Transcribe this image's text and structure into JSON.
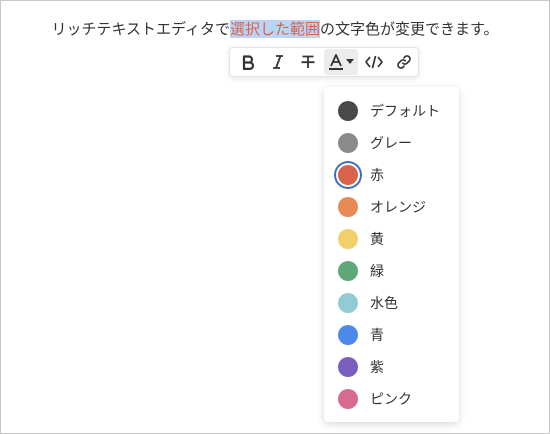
{
  "editor": {
    "text_before": "リッチテキストエディタで",
    "text_selected": "選択した範囲",
    "text_after": "の文字色が変更できます。"
  },
  "toolbar": {
    "buttons": [
      {
        "name": "bold-button",
        "icon": "bold-icon",
        "active": false
      },
      {
        "name": "italic-button",
        "icon": "italic-icon",
        "active": false
      },
      {
        "name": "strikethrough-button",
        "icon": "strikethrough-icon",
        "active": false
      },
      {
        "name": "text-color-button",
        "icon": "text-color-icon",
        "active": true
      },
      {
        "name": "code-button",
        "icon": "code-icon",
        "active": false
      },
      {
        "name": "link-button",
        "icon": "link-icon",
        "active": false
      }
    ]
  },
  "color_menu": {
    "selected": "赤",
    "items": [
      {
        "label": "デフォルト",
        "color": "#4a4a4a"
      },
      {
        "label": "グレー",
        "color": "#8a8a8a"
      },
      {
        "label": "赤",
        "color": "#d8634a"
      },
      {
        "label": "オレンジ",
        "color": "#e88a55"
      },
      {
        "label": "黄",
        "color": "#efd06a"
      },
      {
        "label": "緑",
        "color": "#5fa978"
      },
      {
        "label": "水色",
        "color": "#92cbd3"
      },
      {
        "label": "青",
        "color": "#4c89e8"
      },
      {
        "label": "紫",
        "color": "#7b5fbf"
      },
      {
        "label": "ピンク",
        "color": "#d66a90"
      }
    ]
  }
}
